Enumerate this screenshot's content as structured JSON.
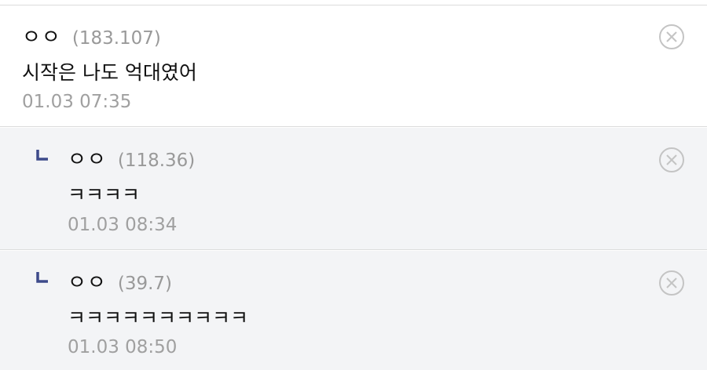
{
  "comments": [
    {
      "author": "ㅇㅇ",
      "ip": "(183.107)",
      "text": "시작은 나도 억대였어",
      "time": "01.03 07:35"
    },
    {
      "author": "ㅇㅇ",
      "ip": "(118.36)",
      "text": "ㅋㅋㅋㅋ",
      "time": "01.03 08:34"
    },
    {
      "author": "ㅇㅇ",
      "ip": "(39.7)",
      "text": "ㅋㅋㅋㅋㅋㅋㅋㅋㅋㅋ",
      "time": "01.03 08:50"
    }
  ],
  "icons": {
    "delete": "close-circle-icon",
    "reply": "reply-arrow-icon"
  },
  "colors": {
    "reply_arrow": "#3d4a8a",
    "reply_bg": "#f3f4f6",
    "meta_text": "#a0a0a0"
  }
}
